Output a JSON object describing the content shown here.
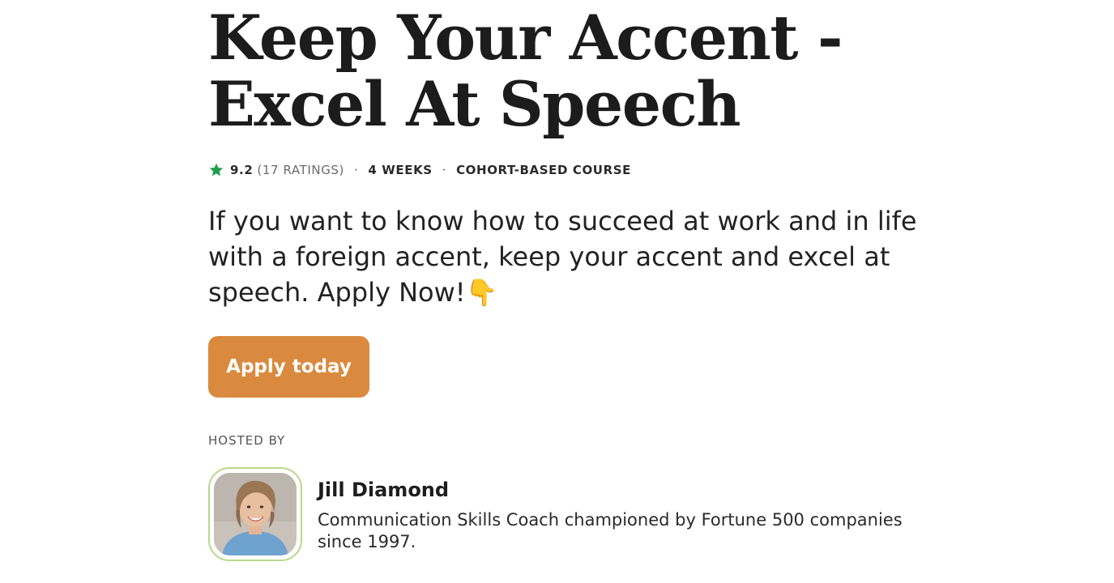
{
  "course": {
    "title": "Keep Your Accent - Excel At Speech",
    "rating": "9.2",
    "ratings_count": "(17 RATINGS)",
    "duration": "4 WEEKS",
    "format": "COHORT-BASED COURSE",
    "description": "If you want to know how to succeed at work and in life with a foreign accent, keep your accent and excel at speech. Apply Now!",
    "description_emoji": "👇"
  },
  "cta": {
    "label": "Apply today"
  },
  "host_section": {
    "label": "HOSTED BY",
    "name": "Jill Diamond",
    "bio": "Communication Skills Coach championed by Fortune 500 companies since 1997."
  },
  "meta_separator": "·",
  "icons": {
    "rating": "star-icon",
    "emoji": "pointing-down-hand"
  },
  "colors": {
    "star": "#1f9e4b",
    "cta_background": "#d98a3f",
    "avatar_border": "#b9d98a"
  }
}
